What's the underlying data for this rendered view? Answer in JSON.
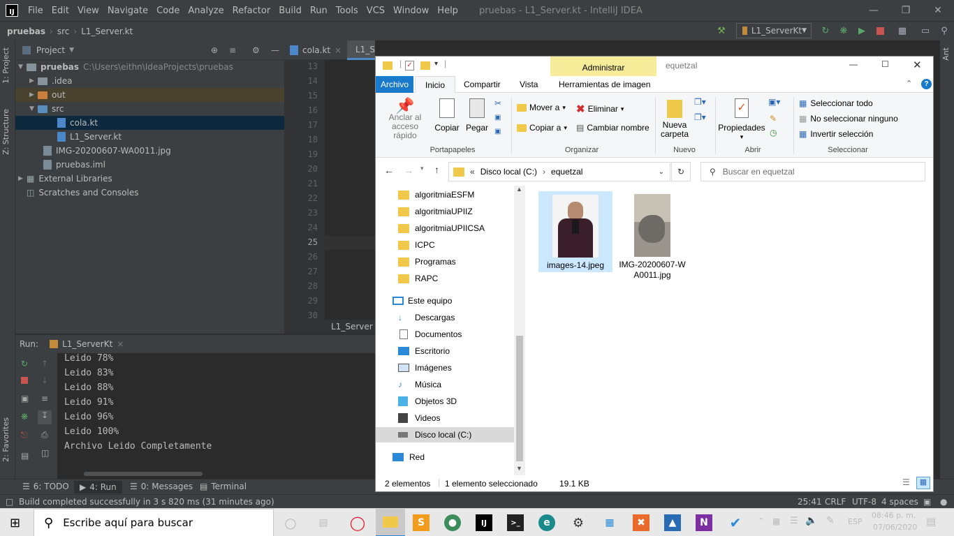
{
  "ide": {
    "menu": [
      "File",
      "Edit",
      "View",
      "Navigate",
      "Code",
      "Analyze",
      "Refactor",
      "Build",
      "Run",
      "Tools",
      "VCS",
      "Window",
      "Help"
    ],
    "window_title": "pruebas - L1_Server.kt - IntelliJ IDEA",
    "breadcrumb": [
      "pruebas",
      "src",
      "L1_Server.kt"
    ],
    "run_config": "L1_ServerKt",
    "side_labels": {
      "project": "1: Project",
      "structure": "Z: Structure",
      "favorites": "2: Favorites",
      "ant": "Ant"
    },
    "project_panel": {
      "title": "Project",
      "tree": [
        {
          "label": "pruebas",
          "path": "C:\\Users\\eithn\\IdeaProjects\\pruebas"
        },
        {
          "label": ".idea"
        },
        {
          "label": "out"
        },
        {
          "label": "src"
        },
        {
          "label": "cola.kt"
        },
        {
          "label": "L1_Server.kt"
        },
        {
          "label": "IMG-20200607-WA0011.jpg"
        },
        {
          "label": "pruebas.iml"
        },
        {
          "label": "External Libraries"
        },
        {
          "label": "Scratches and Consoles"
        }
      ]
    },
    "editor_tabs": [
      "cola.kt",
      "L1_Server.kt"
    ],
    "line_numbers": [
      "13",
      "14",
      "15",
      "16",
      "17",
      "18",
      "19",
      "20",
      "21",
      "22",
      "23",
      "24",
      "25",
      "26",
      "27",
      "28",
      "29",
      "30"
    ],
    "editor_footer": "L1_Server",
    "run_panel": {
      "label": "Run:",
      "tab": "L1_ServerKt",
      "console": [
        "Leido 78%",
        "Leido 83%",
        "Leido 88%",
        "Leido 91%",
        "Leido 96%",
        "Leido 100%",
        "Archivo Leido Completamente"
      ]
    },
    "tool_windows": [
      "6: TODO",
      "4: Run",
      "0: Messages",
      "Terminal"
    ],
    "status": {
      "message": "Build completed successfully in 3 s 820 ms (31 minutes ago)",
      "position": "25:41",
      "line_sep": "CRLF",
      "encoding": "UTF-8",
      "indent": "4 spaces"
    }
  },
  "explorer": {
    "title": "equetzal",
    "context_tab": "Administrar",
    "ribbon_tabs": [
      "Archivo",
      "Inicio",
      "Compartir",
      "Vista",
      "Herramientas de imagen"
    ],
    "groups": {
      "portapapeles": {
        "label": "Portapapeles",
        "pin": "Anclar al acceso rápido",
        "copy": "Copiar",
        "paste": "Pegar"
      },
      "organizar": {
        "label": "Organizar",
        "move": "Mover a",
        "copyto": "Copiar a",
        "delete": "Eliminar",
        "rename": "Cambiar nombre"
      },
      "nuevo": {
        "label": "Nuevo",
        "newfolder": "Nueva carpeta"
      },
      "abrir": {
        "label": "Abrir",
        "props": "Propiedades"
      },
      "seleccionar": {
        "label": "Seleccionar",
        "all": "Seleccionar todo",
        "none": "No seleccionar ninguno",
        "invert": "Invertir selección"
      }
    },
    "address": {
      "prefix": "«",
      "drive": "Disco local (C:)",
      "folder": "equetzal"
    },
    "search_placeholder": "Buscar en equetzal",
    "nav_folders": [
      "algoritmiaESFM",
      "algoritmiaUPIIZ",
      "algoritmiaUPIICSA",
      "ICPC",
      "Programas",
      "RAPC"
    ],
    "nav_pc": "Este equipo",
    "nav_pc_items": [
      "Descargas",
      "Documentos",
      "Escritorio",
      "Imágenes",
      "Música",
      "Objetos 3D",
      "Videos",
      "Disco local (C:)"
    ],
    "nav_network": "Red",
    "files": [
      {
        "name": "images-14.jpeg",
        "selected": true
      },
      {
        "name": "IMG-20200607-WA0011.jpg",
        "selected": false
      }
    ],
    "status": {
      "count": "2 elementos",
      "selected": "1 elemento seleccionado",
      "size": "19.1 KB"
    }
  },
  "taskbar": {
    "search_placeholder": "Escribe aquí para buscar",
    "lang": "ESP",
    "time": "08:46 p. m.",
    "date": "07/06/2020"
  },
  "colors": {
    "ide_bg": "#2b2b2b",
    "ide_panel": "#3c3f41",
    "selection": "#0d293e",
    "ribbon_blue": "#1979ca",
    "admin_tab": "#f6ec9a"
  }
}
